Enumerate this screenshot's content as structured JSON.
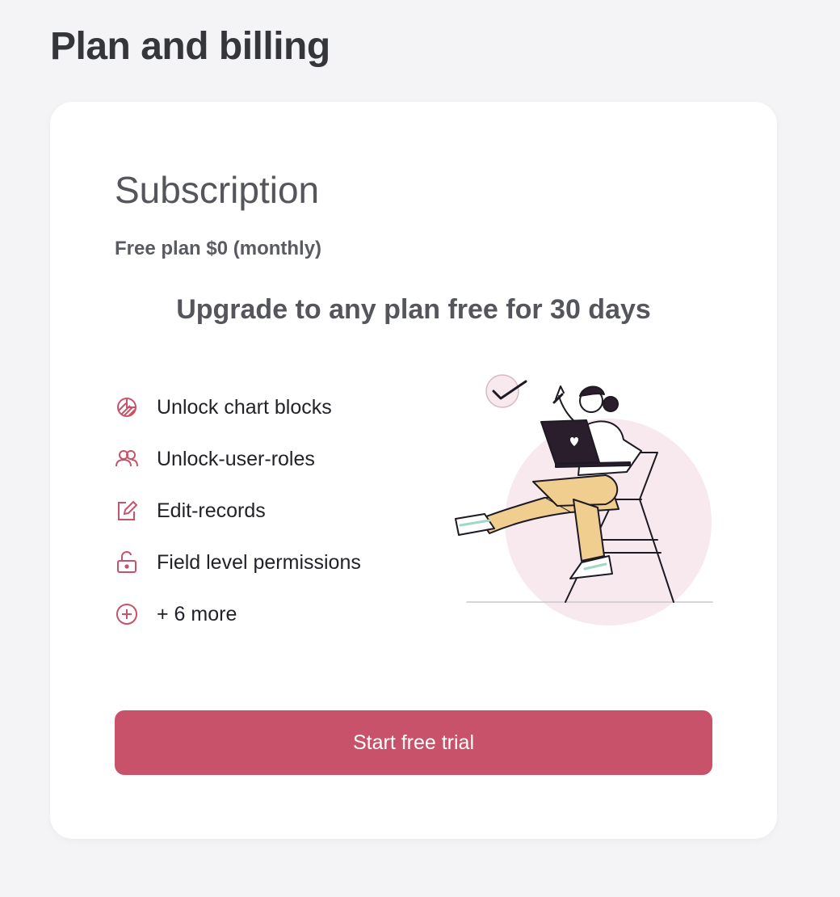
{
  "page": {
    "title": "Plan and billing"
  },
  "subscription": {
    "title": "Subscription",
    "plan": "Free plan $0 (monthly)",
    "headline": "Upgrade to any plan free for 30 days",
    "features": [
      {
        "icon": "chart-icon",
        "label": "Unlock chart blocks"
      },
      {
        "icon": "users-icon",
        "label": "Unlock-user-roles"
      },
      {
        "icon": "edit-icon",
        "label": "Edit-records"
      },
      {
        "icon": "unlock-icon",
        "label": "Field level permissions"
      },
      {
        "icon": "plus-circle-icon",
        "label": "+ 6 more"
      }
    ],
    "cta_label": "Start free trial"
  },
  "colors": {
    "accent": "#c8526a",
    "background": "#f4f4f6",
    "card": "#ffffff",
    "illustration_blob": "#f7e9ee",
    "pants": "#efce8f"
  }
}
